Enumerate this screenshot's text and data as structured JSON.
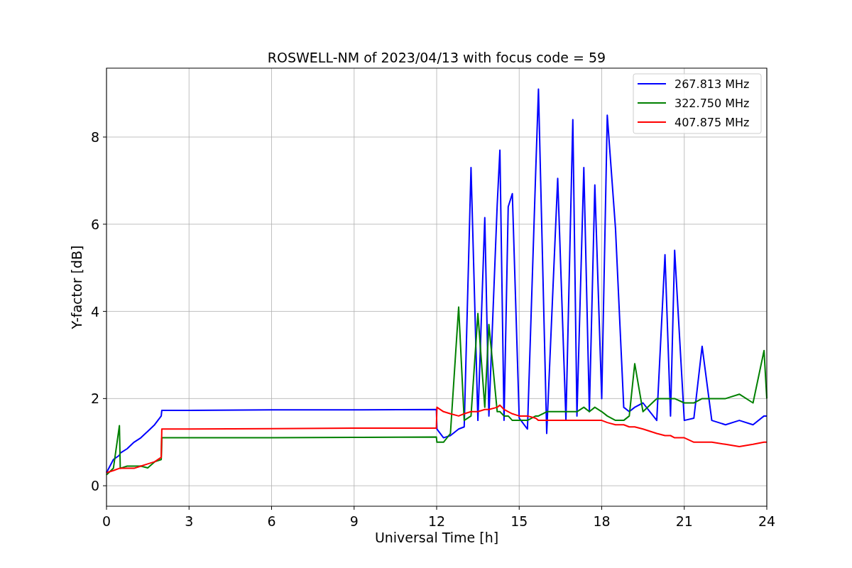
{
  "chart_data": {
    "type": "line",
    "title": "ROSWELL-NM of 2023/04/13 with focus code = 59",
    "xlabel": "Universal Time [h]",
    "ylabel": "Y-factor [dB]",
    "x": [
      0,
      0.25,
      0.47,
      0.5,
      0.75,
      1,
      1.25,
      1.5,
      1.75,
      1.99,
      2.01,
      3,
      6,
      9,
      11.99,
      12.01,
      12.25,
      12.5,
      12.8,
      13,
      13.25,
      13.5,
      13.75,
      13.9,
      14.2,
      14.3,
      14.45,
      14.6,
      14.75,
      15,
      15.3,
      15.6,
      15.7,
      16,
      16.4,
      16.7,
      16.95,
      17.1,
      17.35,
      17.55,
      17.75,
      18,
      18.2,
      18.5,
      18.8,
      19,
      19.2,
      19.5,
      20,
      20.3,
      20.5,
      20.65,
      21,
      21.35,
      21.65,
      22,
      22.5,
      23,
      23.5,
      23.9,
      24
    ],
    "series": [
      {
        "name": "267.813 MHz",
        "color": "#0000ff",
        "values": [
          0.3,
          0.6,
          0.7,
          0.75,
          0.85,
          1.0,
          1.1,
          1.25,
          1.4,
          1.6,
          1.73,
          1.73,
          1.74,
          1.74,
          1.75,
          1.3,
          1.1,
          1.15,
          1.3,
          1.35,
          7.3,
          1.5,
          6.15,
          1.6,
          6.45,
          7.7,
          1.5,
          6.4,
          6.7,
          1.55,
          1.3,
          7.2,
          9.1,
          1.2,
          7.05,
          1.5,
          8.4,
          1.6,
          7.3,
          1.7,
          6.9,
          2.0,
          8.5,
          5.9,
          1.8,
          1.7,
          1.8,
          1.9,
          1.5,
          5.3,
          1.6,
          5.4,
          1.5,
          1.55,
          3.2,
          1.5,
          1.4,
          1.5,
          1.4,
          1.6,
          1.6
        ]
      },
      {
        "name": "322.750 MHz",
        "color": "#008000",
        "values": [
          0.25,
          0.4,
          1.38,
          0.4,
          0.45,
          0.45,
          0.45,
          0.41,
          0.55,
          0.6,
          1.1,
          1.1,
          1.1,
          1.11,
          1.12,
          1.0,
          1.0,
          1.2,
          4.1,
          1.5,
          1.6,
          3.95,
          1.8,
          3.7,
          1.7,
          1.7,
          1.6,
          1.6,
          1.5,
          1.5,
          1.5,
          1.6,
          1.6,
          1.7,
          1.7,
          1.7,
          1.7,
          1.7,
          1.8,
          1.7,
          1.8,
          1.7,
          1.6,
          1.5,
          1.5,
          1.6,
          2.8,
          1.7,
          2.0,
          2.0,
          2.0,
          2.0,
          1.9,
          1.9,
          2.0,
          2.0,
          2.0,
          2.1,
          1.9,
          3.1,
          2.0
        ]
      },
      {
        "name": "407.875 MHz",
        "color": "#ff0000",
        "values": [
          0.3,
          0.35,
          0.4,
          0.4,
          0.4,
          0.4,
          0.45,
          0.5,
          0.55,
          0.65,
          1.3,
          1.3,
          1.31,
          1.32,
          1.32,
          1.8,
          1.7,
          1.65,
          1.6,
          1.65,
          1.7,
          1.7,
          1.75,
          1.75,
          1.8,
          1.85,
          1.75,
          1.7,
          1.65,
          1.6,
          1.6,
          1.55,
          1.5,
          1.5,
          1.5,
          1.5,
          1.5,
          1.5,
          1.5,
          1.5,
          1.5,
          1.5,
          1.45,
          1.4,
          1.4,
          1.35,
          1.35,
          1.3,
          1.2,
          1.15,
          1.15,
          1.1,
          1.1,
          1.0,
          1.0,
          1.0,
          0.95,
          0.9,
          0.95,
          1.0,
          1.0
        ]
      }
    ],
    "xlim": [
      0,
      24
    ],
    "ylim": [
      -0.47,
      9.58
    ],
    "xticks": [
      0,
      3,
      6,
      9,
      12,
      15,
      18,
      21,
      24
    ],
    "yticks": [
      0,
      2,
      4,
      6,
      8
    ],
    "grid": true,
    "legend": "upper right"
  }
}
